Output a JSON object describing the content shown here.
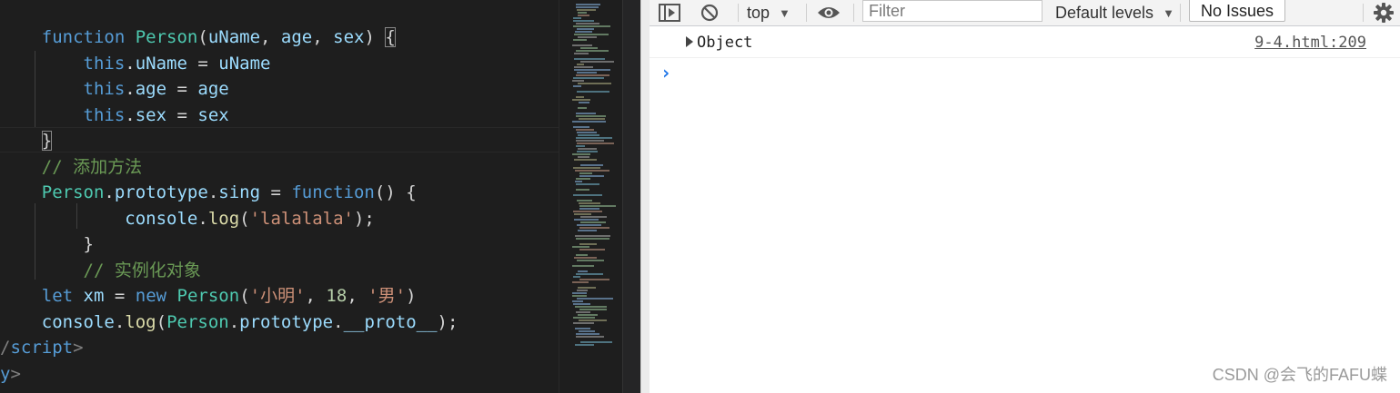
{
  "editor": {
    "lines": [
      {
        "tokens": [
          [
            "    ",
            "pun"
          ],
          [
            "function",
            "kw"
          ],
          [
            " ",
            "pun"
          ],
          [
            "Person",
            "cls"
          ],
          [
            "(",
            "pun"
          ],
          [
            "uName",
            "prop"
          ],
          [
            ", ",
            "pun"
          ],
          [
            "age",
            "prop"
          ],
          [
            ", ",
            "pun"
          ],
          [
            "sex",
            "prop"
          ],
          [
            ") ",
            "pun"
          ],
          [
            "{",
            "pun brace-box"
          ]
        ]
      },
      {
        "tokens": [
          [
            "        ",
            "pun"
          ],
          [
            "this",
            "kw"
          ],
          [
            ".",
            "pun"
          ],
          [
            "uName",
            "prop"
          ],
          [
            " = ",
            "pun"
          ],
          [
            "uName",
            "prop"
          ]
        ]
      },
      {
        "tokens": [
          [
            "        ",
            "pun"
          ],
          [
            "this",
            "kw"
          ],
          [
            ".",
            "pun"
          ],
          [
            "age",
            "prop"
          ],
          [
            " = ",
            "pun"
          ],
          [
            "age",
            "prop"
          ]
        ]
      },
      {
        "tokens": [
          [
            "        ",
            "pun"
          ],
          [
            "this",
            "kw"
          ],
          [
            ".",
            "pun"
          ],
          [
            "sex",
            "prop"
          ],
          [
            " = ",
            "pun"
          ],
          [
            "sex",
            "prop"
          ]
        ]
      },
      {
        "tokens": [
          [
            "    ",
            "pun"
          ],
          [
            "}",
            "pun brace-box"
          ]
        ]
      },
      {
        "tokens": [
          [
            "    ",
            "pun"
          ],
          [
            "// 添加方法",
            "cmt"
          ]
        ]
      },
      {
        "tokens": [
          [
            "    ",
            "pun"
          ],
          [
            "Person",
            "cls"
          ],
          [
            ".",
            "pun"
          ],
          [
            "prototype",
            "prop"
          ],
          [
            ".",
            "pun"
          ],
          [
            "sing",
            "prop"
          ],
          [
            " = ",
            "pun"
          ],
          [
            "function",
            "kw"
          ],
          [
            "() {",
            "pun"
          ]
        ]
      },
      {
        "tokens": [
          [
            "            ",
            "pun"
          ],
          [
            "console",
            "prop"
          ],
          [
            ".",
            "pun"
          ],
          [
            "log",
            "fn"
          ],
          [
            "(",
            "pun"
          ],
          [
            "'lalalala'",
            "str"
          ],
          [
            ");",
            "pun"
          ]
        ]
      },
      {
        "tokens": [
          [
            "        ",
            "pun"
          ],
          [
            "}",
            "pun"
          ]
        ]
      },
      {
        "tokens": [
          [
            "        ",
            "pun"
          ],
          [
            "// 实例化对象",
            "cmt"
          ]
        ]
      },
      {
        "tokens": [
          [
            "    ",
            "pun"
          ],
          [
            "let",
            "kw"
          ],
          [
            " ",
            "pun"
          ],
          [
            "xm",
            "prop"
          ],
          [
            " = ",
            "pun"
          ],
          [
            "new",
            "kw"
          ],
          [
            " ",
            "pun"
          ],
          [
            "Person",
            "cls"
          ],
          [
            "(",
            "pun"
          ],
          [
            "'小明'",
            "str"
          ],
          [
            ", ",
            "pun"
          ],
          [
            "18",
            "num"
          ],
          [
            ", ",
            "pun"
          ],
          [
            "'男'",
            "str"
          ],
          [
            ")",
            "pun"
          ]
        ]
      },
      {
        "tokens": [
          [
            "    ",
            "pun"
          ],
          [
            "console",
            "prop"
          ],
          [
            ".",
            "pun"
          ],
          [
            "log",
            "fn"
          ],
          [
            "(",
            "pun"
          ],
          [
            "Person",
            "cls"
          ],
          [
            ".",
            "pun"
          ],
          [
            "prototype",
            "prop"
          ],
          [
            ".",
            "pun"
          ],
          [
            "__proto__",
            "prop"
          ],
          [
            ");",
            "pun"
          ]
        ]
      },
      {
        "tokens": [
          [
            "/",
            "tag"
          ],
          [
            "script",
            "tagname"
          ],
          [
            ">",
            "tag"
          ]
        ]
      },
      {
        "tokens": [
          [
            "y",
            "tagname"
          ],
          [
            ">",
            "tag"
          ]
        ]
      }
    ]
  },
  "devtools": {
    "toolbar": {
      "context_label": "top",
      "context_arrow": "▼",
      "filter_placeholder": "Filter",
      "levels_label": "Default levels",
      "levels_arrow": "▼",
      "issues_label": "No Issues",
      "icons": [
        "sidebar-toggle-icon",
        "clear-console-icon",
        "eye-icon",
        "gear-icon"
      ]
    },
    "log": {
      "text": "Object",
      "source": "9-4.html:209"
    },
    "prompt": "›"
  },
  "watermark": "CSDN @会飞的FAFU蝶",
  "colors": {
    "editor_bg": "#1e1e1e",
    "keyword": "#569cd6",
    "class": "#4ec9b0",
    "property": "#9cdcfe",
    "function": "#dcdcaa",
    "string": "#ce9178",
    "number": "#b5cea8",
    "comment": "#6a9955",
    "console_prompt": "#1a73e8"
  }
}
